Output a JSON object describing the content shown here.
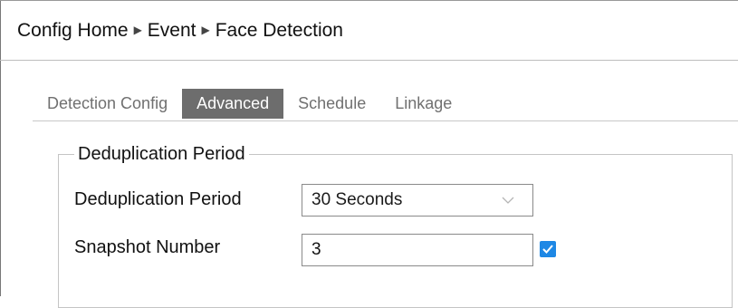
{
  "breadcrumb": {
    "items": [
      "Config Home",
      "Event",
      "Face Detection"
    ],
    "separator_icon": "triangle-right-icon"
  },
  "tabs": [
    {
      "label": "Detection Config",
      "active": false
    },
    {
      "label": "Advanced",
      "active": true
    },
    {
      "label": "Schedule",
      "active": false
    },
    {
      "label": "Linkage",
      "active": false
    }
  ],
  "section": {
    "legend": "Deduplication Period",
    "dedup_period": {
      "label": "Deduplication Period",
      "value": "30 Seconds",
      "icon": "chevron-down-icon"
    },
    "snapshot": {
      "label": "Snapshot Number",
      "value": "3",
      "checked": true
    }
  },
  "colors": {
    "active_tab_bg": "#6d6d6d",
    "checkbox_accent": "#1e88e5"
  }
}
